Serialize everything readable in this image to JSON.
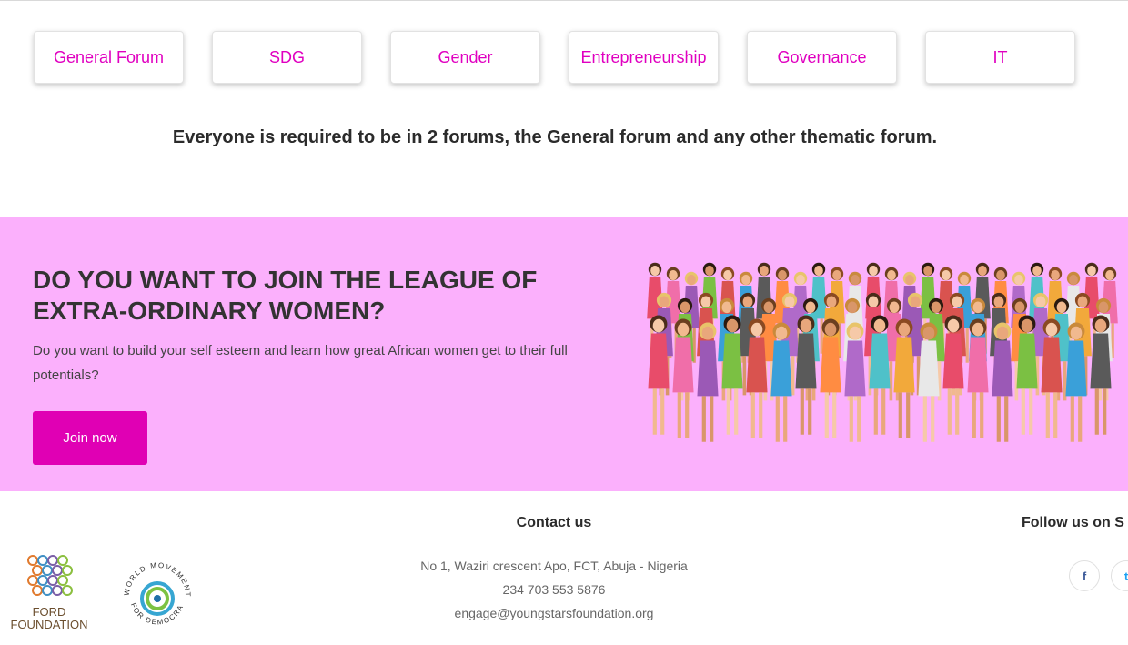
{
  "forums": [
    {
      "label": "General Forum"
    },
    {
      "label": "SDG"
    },
    {
      "label": "Gender"
    },
    {
      "label": "Entrepreneurship"
    },
    {
      "label": "Governance"
    },
    {
      "label": "IT"
    }
  ],
  "notice": "Everyone is required to be in 2 forums, the General forum and any other thematic forum.",
  "hero": {
    "title": "DO YOU WANT TO JOIN THE LEAGUE OF EXTRA-ORDINARY WOMEN?",
    "text": "Do you want to build your self esteem and learn how great African women get to their full potentials?",
    "button": "Join now",
    "image": "crowd-of-women-illustration",
    "background": "#fbb0fc"
  },
  "footer": {
    "contact_title": "Contact us",
    "address": "No 1, Waziri crescent Apo, FCT, Abuja - Nigeria",
    "phone": "234 703 553 5876",
    "email": "engage@youngstarsfoundation.org",
    "follow_title": "Follow us on S",
    "social": [
      {
        "icon": "facebook-icon",
        "glyph": "f"
      },
      {
        "icon": "twitter-icon",
        "glyph": "t"
      }
    ],
    "partners": {
      "ford": "FORD FOUNDATION",
      "wmd_top": "WORLD MOVEMENT",
      "wmd_bottom": "FOR DEMOCRACY"
    }
  },
  "colors": {
    "accent": "#e000c0",
    "button": "#e000b4"
  }
}
